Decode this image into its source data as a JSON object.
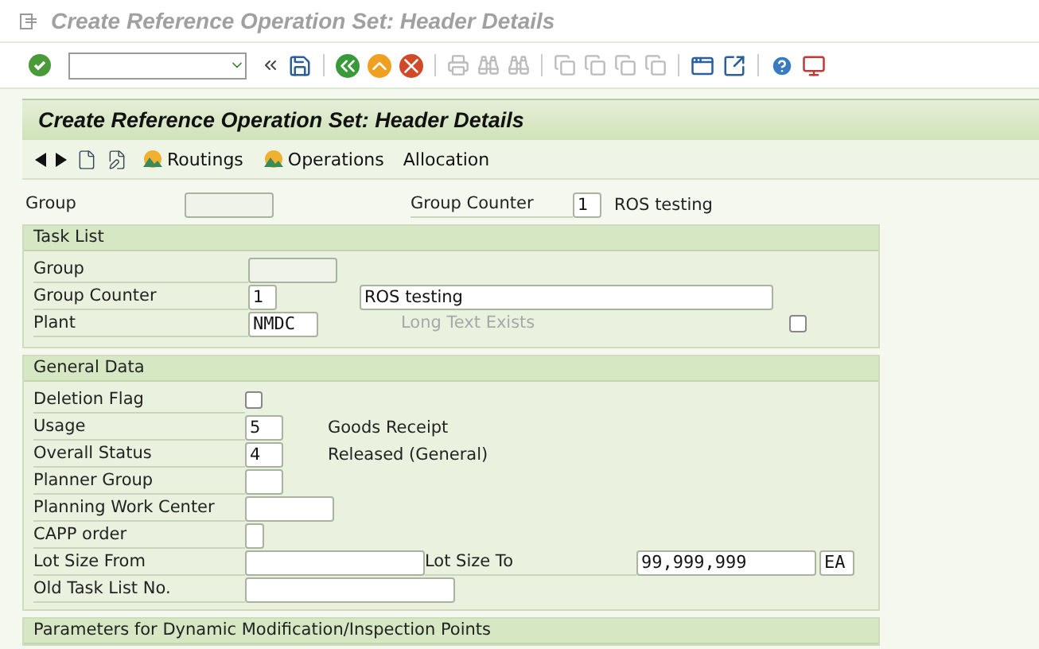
{
  "window": {
    "title": "Create Reference Operation Set: Header Details"
  },
  "screen_title": "Create Reference Operation Set: Header Details",
  "app_toolbar": [
    {
      "kind": "icon"
    },
    {
      "kind": "icon"
    },
    {
      "kind": "icon"
    },
    {
      "kind": "icon"
    },
    {
      "kind": "iconlabel",
      "label": "Routings"
    },
    {
      "kind": "iconlabel",
      "label": "Operations"
    },
    {
      "kind": "text",
      "label": "Allocation"
    }
  ],
  "header_fields": [
    {
      "label": "Group"
    },
    {
      "label": "Group Counter",
      "value": "1",
      "description": "ROS testing"
    }
  ],
  "sections": [
    {
      "title": "Task List",
      "rows": [
        {
          "label": "Group",
          "control": {
            "kind": "input"
          },
          "after": []
        },
        {
          "label": "Group Counter",
          "control": {
            "kind": "input",
            "value": "1"
          },
          "after": [
            {
              "kind": "input",
              "value": "ROS testing"
            }
          ]
        },
        {
          "label": "Plant",
          "control": {
            "kind": "input",
            "value": "NMDC"
          },
          "after": [
            {
              "kind": "label",
              "value": "Long Text Exists",
              "disabled": true
            },
            {
              "kind": "checkbox",
              "checked": false
            }
          ]
        }
      ]
    },
    {
      "title": "General Data",
      "rows": [
        {
          "label": "Deletion Flag",
          "control": {
            "kind": "checkbox",
            "checked": false
          },
          "after": []
        },
        {
          "label": "Usage",
          "control": {
            "kind": "input",
            "value": "5"
          },
          "after": [
            {
              "kind": "text",
              "value": "Goods Receipt"
            }
          ]
        },
        {
          "label": "Overall Status",
          "control": {
            "kind": "input",
            "value": "4"
          },
          "after": [
            {
              "kind": "text",
              "value": "Released (General)"
            }
          ]
        },
        {
          "label": "Planner Group",
          "control": {
            "kind": "input"
          },
          "after": []
        },
        {
          "label": "Planning Work Center",
          "control": {
            "kind": "input"
          },
          "after": []
        },
        {
          "label": "CAPP order",
          "control": {
            "kind": "input"
          },
          "after": []
        },
        {
          "label": "Lot Size From",
          "control": {
            "kind": "input"
          },
          "after": [
            {
              "kind": "label",
              "value": "Lot Size To",
              "disabled": false
            },
            {
              "kind": "input",
              "value": "99,999,999"
            },
            {
              "kind": "input",
              "value": "EA"
            }
          ]
        },
        {
          "label": "Old Task List No.",
          "control": {
            "kind": "input"
          },
          "after": []
        }
      ]
    },
    {
      "title": "Parameters for Dynamic Modification/Inspection Points"
    }
  ]
}
